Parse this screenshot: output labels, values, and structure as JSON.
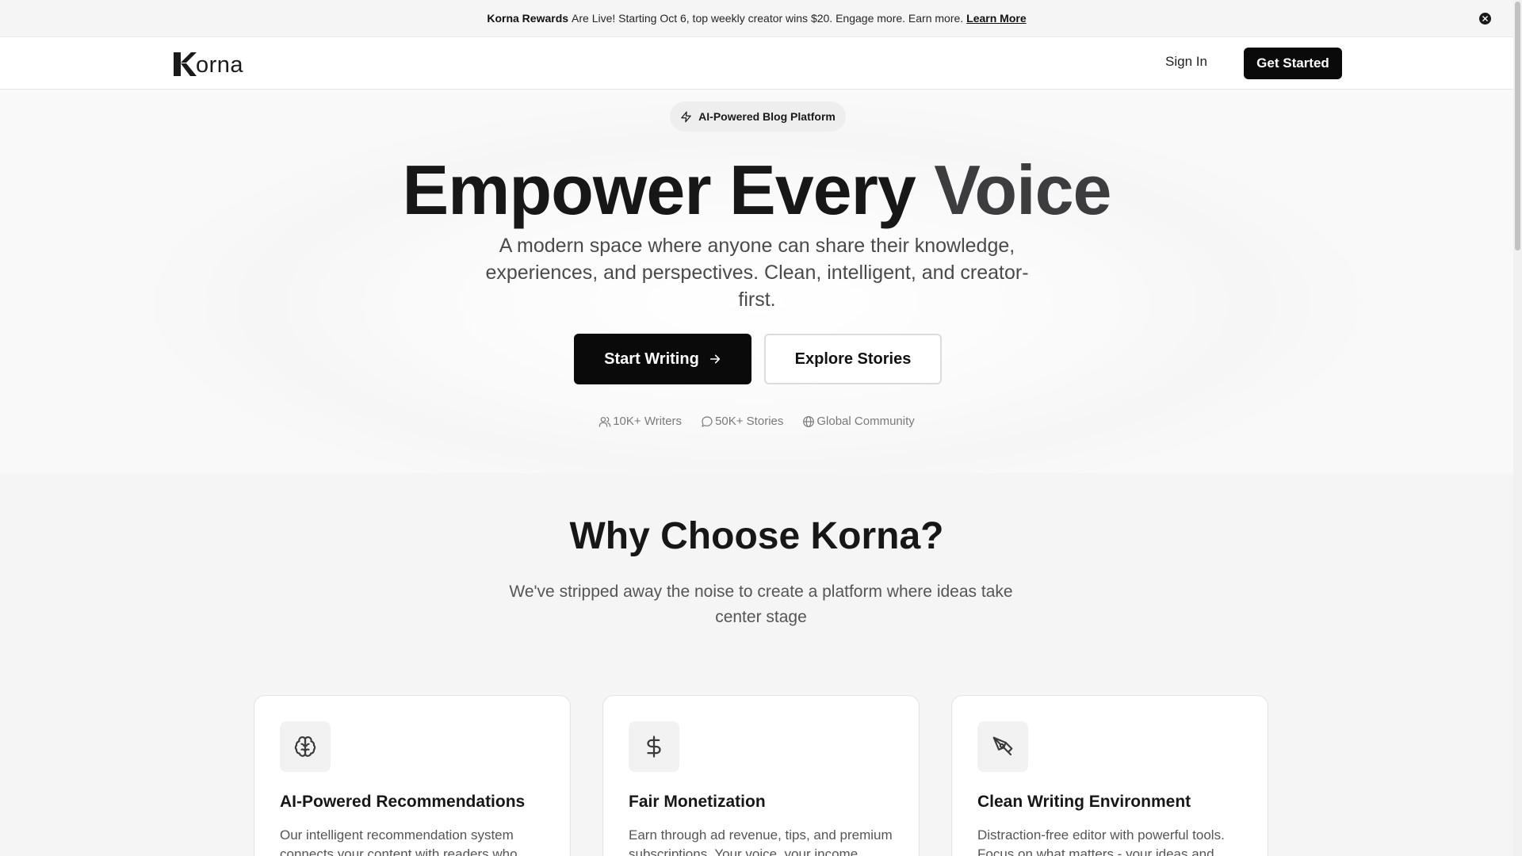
{
  "banner": {
    "brand": "Korna Rewards",
    "message": "Are Live! Starting Oct 6, top weekly creator wins $20. Engage more. Earn more.",
    "link": "Learn More",
    "close_icon": "close-circle-icon"
  },
  "header": {
    "logo_text": "orna",
    "sign_in": "Sign In",
    "get_started": "Get Started"
  },
  "hero": {
    "pill": "AI-Powered Blog Platform",
    "pill_icon": "lightning-icon",
    "headline_main": "Empower Every",
    "headline_accent": "Voice",
    "subtitle": "A modern space where anyone can share their knowledge, experiences, and perspectives. Clean, intelligent, and creator-first.",
    "primary_cta": "Start Writing",
    "secondary_cta": "Explore Stories",
    "stats": [
      {
        "icon": "users-icon",
        "label": "10K+ Writers"
      },
      {
        "icon": "message-circle-icon",
        "label": "50K+ Stories"
      },
      {
        "icon": "globe-icon",
        "label": "Global Community"
      }
    ]
  },
  "features": {
    "title": "Why Choose Korna?",
    "description": "We've stripped away the noise to create a platform where ideas take center stage",
    "cards": [
      {
        "icon": "brain-icon",
        "title": "AI-Powered Recommendations",
        "text": "Our intelligent recommendation system connects your content with readers who"
      },
      {
        "icon": "dollar-sign-icon",
        "title": "Fair Monetization",
        "text": "Earn through ad revenue, tips, and premium subscriptions. Your voice, your income"
      },
      {
        "icon": "pen-tool-icon",
        "title": "Clean Writing Environment",
        "text": "Distraction-free editor with powerful tools. Focus on what matters - your ideas and"
      }
    ]
  },
  "colors": {
    "primary": "#0a0a0a",
    "accent_text": "#3d3d3f",
    "muted": "#7a7a7a",
    "section_bg": "#f5f5f5"
  }
}
